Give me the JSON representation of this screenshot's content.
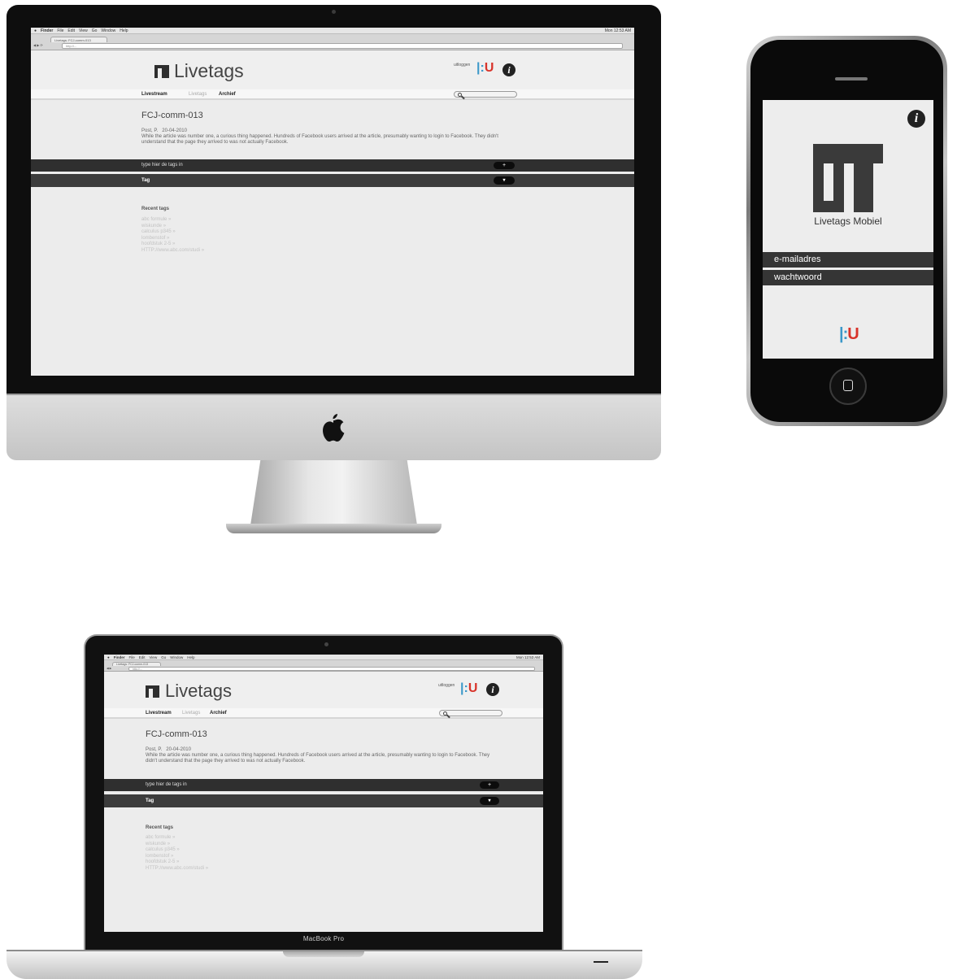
{
  "os_menu": {
    "apple": "",
    "app_name": "Finder",
    "items": [
      "File",
      "Edit",
      "View",
      "Go",
      "Window",
      "Help"
    ],
    "clock": "Mon 12:53 AM"
  },
  "browser": {
    "tab_title": "Livetags: FCJ-comm-013",
    "address": "http://..."
  },
  "site": {
    "brand": "Livetags",
    "uitlogger_label": "uitloggen",
    "hu_logo_left": "|:",
    "hu_logo_right": "U",
    "info_label": "i",
    "nav": {
      "livestream": "Livestream",
      "livetags": "Livetags",
      "archief": "Archief"
    },
    "search_placeholder": ""
  },
  "article": {
    "title": "FCJ-comm-013",
    "author": "Post, P.",
    "date": "20-04-2010",
    "body": "While the article was number one, a curious thing happened. Hundreds of Facebook users arrived at the article, presumably wanting to login to Facebook. They didn't understand that the page they arrived to was not actually Facebook."
  },
  "tag_input": {
    "placeholder": "type hier de tags in",
    "button": "+"
  },
  "tag_bar": {
    "label": "Tag",
    "button": "▾"
  },
  "recent_tags": {
    "heading": "Recent tags",
    "items": [
      "abc formule",
      "wiskunde",
      "calculus p345",
      "lombenstof",
      "hoofdstuk 2-5",
      "HTTP://www.abc.com/studi"
    ],
    "suffix": "»"
  },
  "macbook_label": "MacBook Pro",
  "mobile": {
    "app_name": "Livetags Mobiel",
    "email_field": "e-mailadres",
    "password_field": "wachtwoord",
    "info_label": "i",
    "hu_logo_left": "|:",
    "hu_logo_right": "U"
  },
  "colors": {
    "hu_blue": "#3b98c9",
    "hu_red": "#d8332a",
    "bar_dark": "#2f2f2f",
    "screen_bg": "#ececec"
  }
}
